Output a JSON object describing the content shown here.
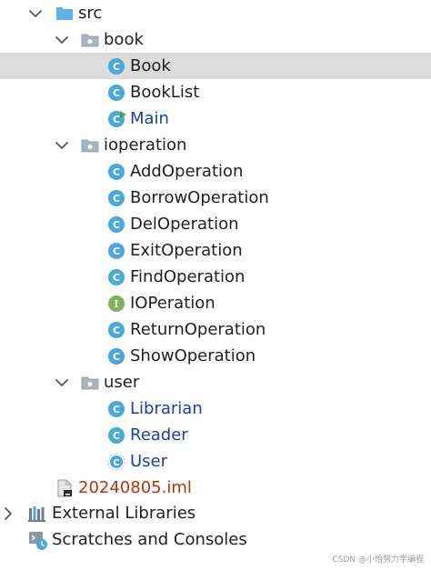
{
  "tree": {
    "src": "src",
    "book": "book",
    "Book": "Book",
    "BookList": "BookList",
    "Main": "Main",
    "ioperation": "ioperation",
    "AddOperation": "AddOperation",
    "BorrowOperation": "BorrowOperation",
    "DelOperation": "DelOperation",
    "ExitOperation": "ExitOperation",
    "FindOperation": "FindOperation",
    "IOPeration": "IOPeration",
    "ReturnOperation": "ReturnOperation",
    "ShowOperation": "ShowOperation",
    "user": "user",
    "Librarian": "Librarian",
    "Reader": "Reader",
    "User": "User",
    "iml": "20240805.iml",
    "external_libraries": "External Libraries",
    "scratches": "Scratches and Consoles"
  },
  "icons": {
    "class_glyph": "C",
    "interface_glyph": "I"
  },
  "colors": {
    "selection": "#dcdcdc",
    "class_icon": "#4aa8db",
    "interface_icon": "#7cb45a",
    "modified_text": "#1d3f9f",
    "untracked_text": "#b5350b",
    "folder_src": "#5db2e8",
    "folder_package": "#9aa4b0"
  },
  "watermark": "CSDN @小怡努力学编程"
}
